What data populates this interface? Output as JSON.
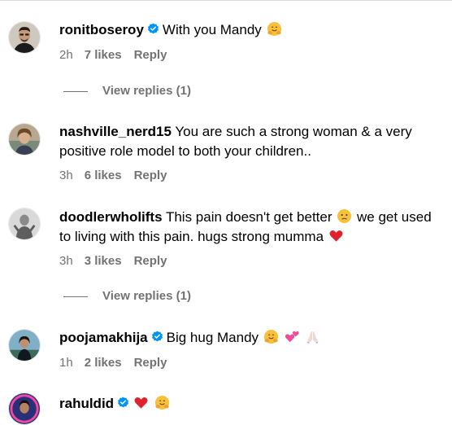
{
  "comments": [
    {
      "username": "ronitboseroy",
      "verified": true,
      "text": "With you Mandy",
      "emojis": [
        "hugging-face-emoji"
      ],
      "time": "2h",
      "likes": "7 likes",
      "reply": "Reply",
      "view_replies": "View replies (1)"
    },
    {
      "username": "nashville_nerd15",
      "verified": false,
      "text": "You are such a strong woman & a very positive role model to both your children..",
      "time": "3h",
      "likes": "6 likes",
      "reply": "Reply"
    },
    {
      "username": "doodlerwholifts",
      "verified": false,
      "text_part1": "This pain doesn't get better",
      "text_part2": "we get used to living with this pain. hugs strong mumma",
      "emojis": [
        "sad-face-emoji",
        "red-heart-emoji"
      ],
      "time": "3h",
      "likes": "3 likes",
      "reply": "Reply",
      "view_replies": "View replies (1)"
    },
    {
      "username": "poojamakhija",
      "verified": true,
      "text": "Big hug Mandy",
      "emojis": [
        "hugging-face-emoji",
        "two-hearts-emoji",
        "praying-hands-emoji"
      ],
      "time": "1h",
      "likes": "2 likes",
      "reply": "Reply"
    },
    {
      "username": "rahuldid",
      "verified": true,
      "text": "",
      "emojis": [
        "red-heart-emoji",
        "hugging-face-emoji"
      ]
    }
  ],
  "colors": {
    "meta_gray": "#737373",
    "verified_blue": "#0095f6",
    "heart_red": "#e0222e"
  }
}
